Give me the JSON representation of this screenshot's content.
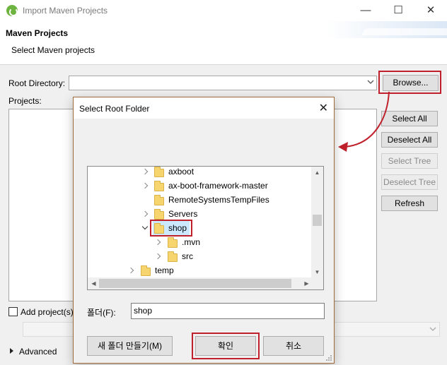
{
  "window": {
    "title": "Import Maven Projects",
    "minimize": "—",
    "maximize": "☐",
    "close": "✕"
  },
  "header": {
    "title": "Maven Projects",
    "subtitle": "Select Maven projects"
  },
  "root_directory": {
    "label": "Root Directory:",
    "value": "",
    "browse_label": "Browse..."
  },
  "projects": {
    "label": "Projects:",
    "buttons": {
      "select_all": "Select All",
      "deselect_all": "Deselect All",
      "select_tree": "Select Tree",
      "deselect_tree": "Deselect Tree",
      "refresh": "Refresh"
    }
  },
  "add_projects_label": "Add project(s)",
  "advanced_label": "Advanced",
  "dialog": {
    "title": "Select Root Folder",
    "close": "✕",
    "tree": [
      {
        "name": "axboot",
        "expanded": false
      },
      {
        "name": "ax-boot-framework-master",
        "expanded": false
      },
      {
        "name": "RemoteSystemsTempFiles",
        "expanded": false
      },
      {
        "name": "Servers",
        "expanded": false
      },
      {
        "name": "shop",
        "expanded": true,
        "selected": true
      },
      {
        "name": ".mvn",
        "expanded": false
      },
      {
        "name": "src",
        "expanded": false
      },
      {
        "name": "temp",
        "expanded": false
      }
    ],
    "folder_label": "폴더(F):",
    "folder_value": "shop",
    "new_folder_label": "새 폴더 만들기(M)",
    "ok_label": "확인",
    "cancel_label": "취소"
  },
  "colors": {
    "highlight_red": "#c0202b",
    "selection": "#cce8ff",
    "folder": "#f6d46e"
  }
}
